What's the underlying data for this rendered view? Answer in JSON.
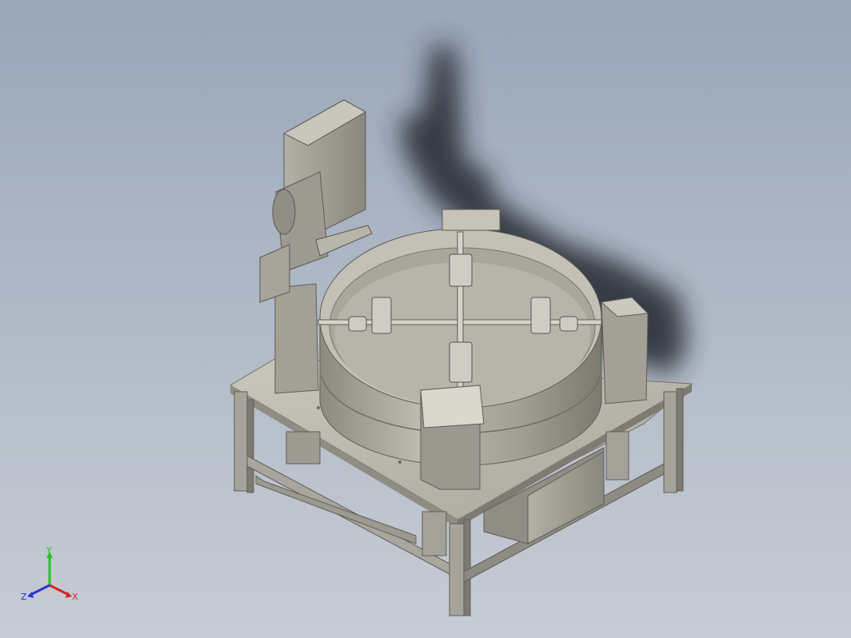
{
  "viewport": {
    "background_top": "#9aa6b9",
    "background_bottom": "#c6ccd4"
  },
  "model": {
    "shadow_color": "#23272d",
    "metal_color": "#a8a699",
    "metal_dark": "#6f6e66",
    "metal_light": "#d8d6cc"
  },
  "triad": {
    "x_label": "X",
    "y_label": "Y",
    "z_label": "Z",
    "x_color": "#d0262b",
    "y_color": "#26c02e",
    "z_color": "#2934d8"
  }
}
